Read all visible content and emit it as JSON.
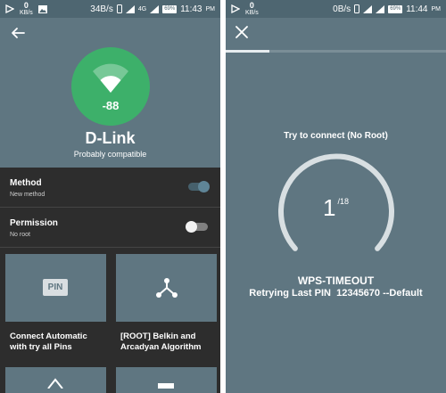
{
  "left_screen": {
    "status_bar": {
      "net_speed_value": "0",
      "net_speed_unit": "KB/s",
      "speed_text": "34B/s",
      "net_type": "4G",
      "battery": "69%",
      "time": "11:43",
      "ampm": "PM"
    },
    "network": {
      "signal": "-88",
      "ssid": "D-Link",
      "compatibility": "Probably compatible",
      "signal_color": "#3db06a"
    },
    "settings": [
      {
        "title": "Method",
        "subtitle": "New method",
        "enabled": true
      },
      {
        "title": "Permission",
        "subtitle": "No root",
        "enabled": false
      }
    ],
    "cards": [
      {
        "icon": "pin-icon",
        "icon_text": "PIN",
        "label_line1": "Connect Automatic",
        "label_line2": "with try all Pins"
      },
      {
        "icon": "network-tree-icon",
        "label_line1": "[ROOT] Belkin and",
        "label_line2": "Arcadyan Algorithm"
      }
    ]
  },
  "right_screen": {
    "status_bar": {
      "net_speed_value": "0",
      "net_speed_unit": "KB/s",
      "speed_text": "0B/s",
      "battery": "69%",
      "time": "11:44",
      "ampm": "PM"
    },
    "progress": 0.2,
    "try_label": "Try to connect (No Root)",
    "attempt_current": "1",
    "attempt_total": "/18",
    "status": "WPS-TIMEOUT",
    "retry_text": "Retrying Last PIN  12345670 --Default"
  }
}
